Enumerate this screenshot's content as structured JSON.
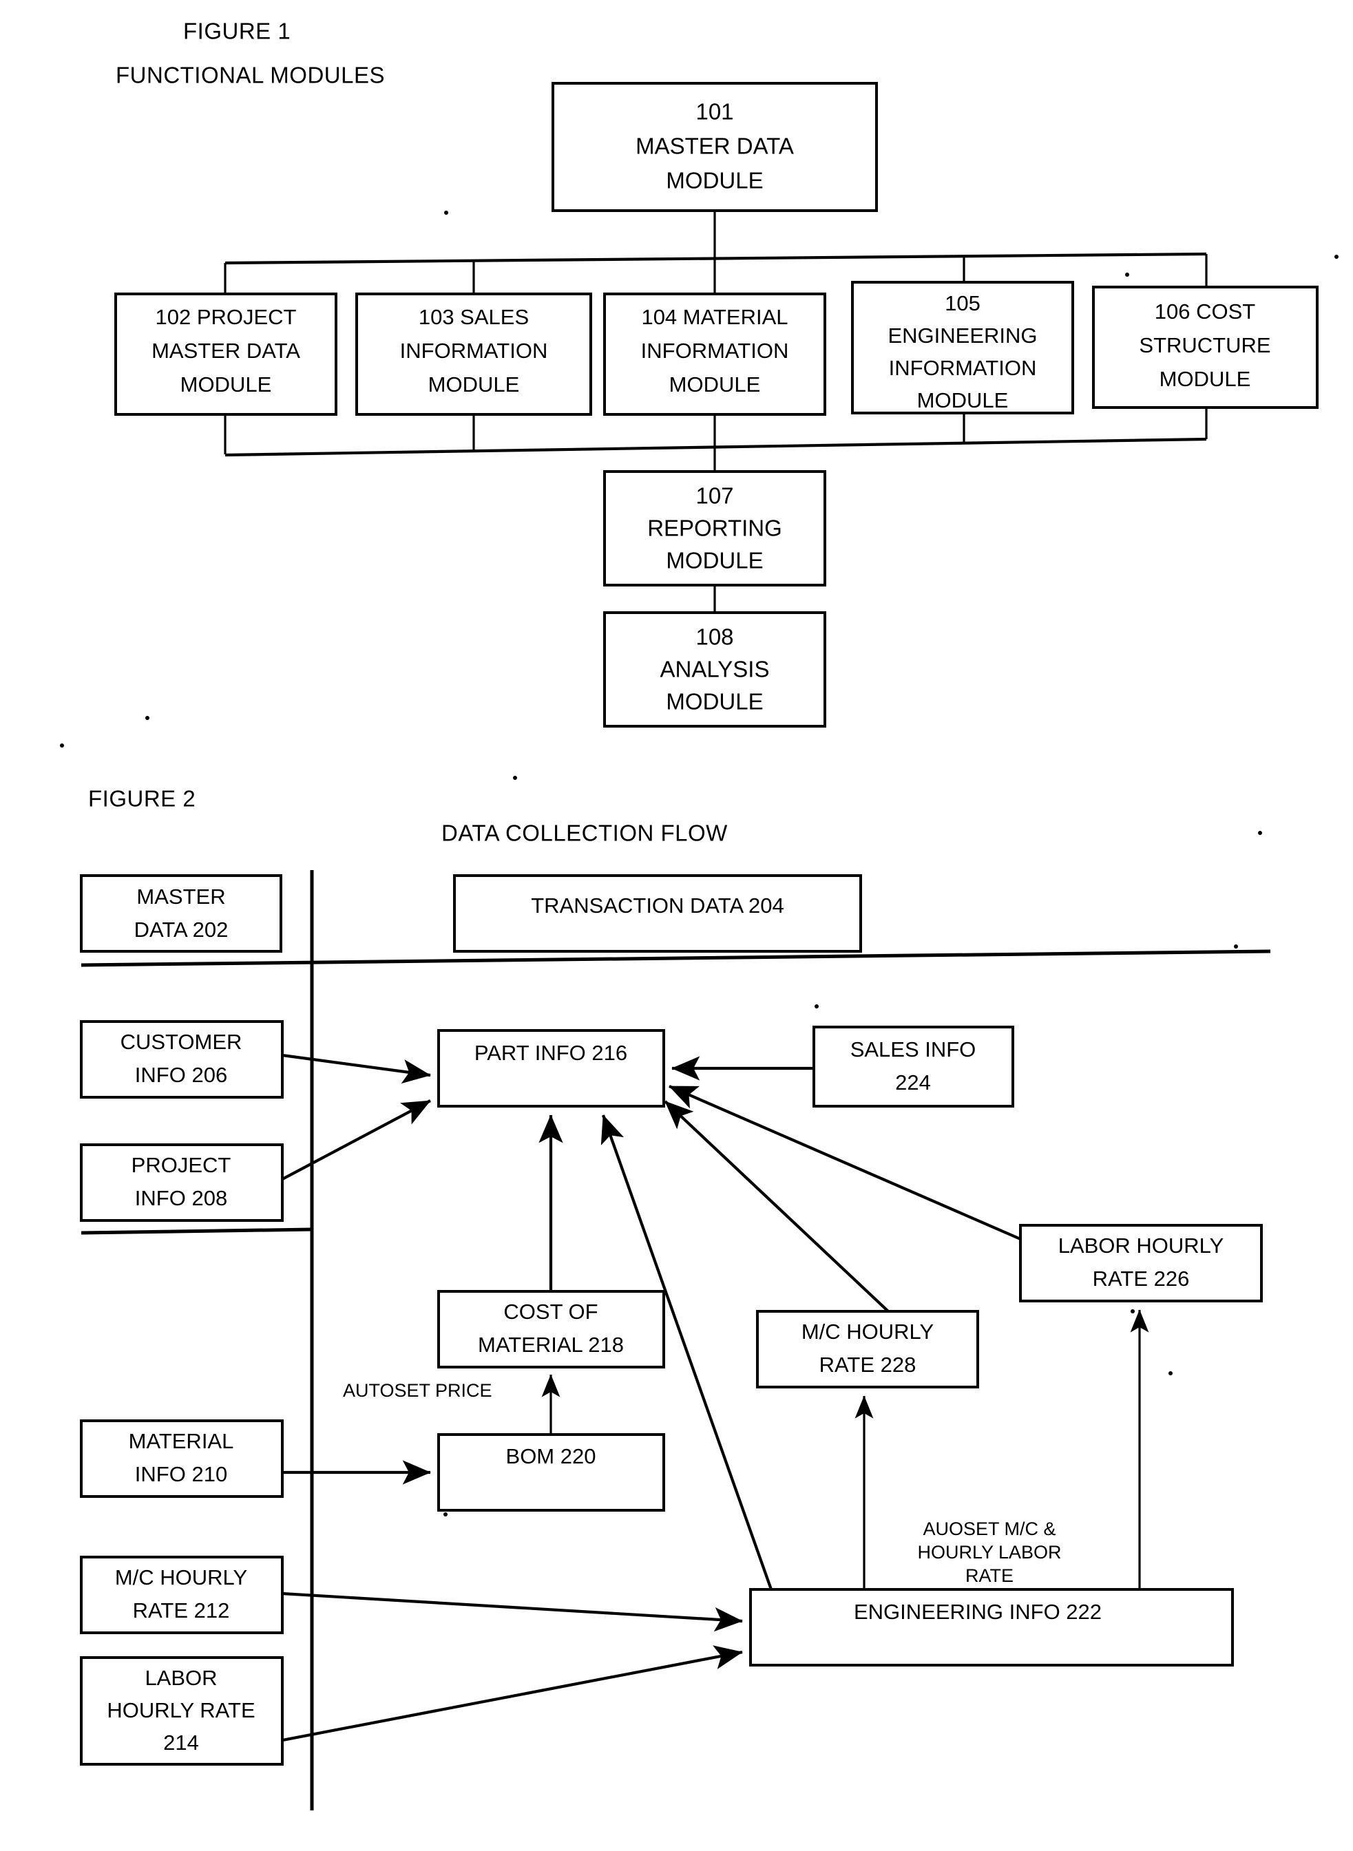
{
  "sheet": {
    "figure1": {
      "figure_label": "FIGURE 1",
      "heading": "FUNCTIONAL MODULES",
      "boxes": {
        "master": {
          "line1": "101",
          "line2": "MASTER DATA",
          "line3": "MODULE"
        },
        "project": {
          "line1": "102 PROJECT",
          "line2": "MASTER DATA",
          "line3": "MODULE"
        },
        "sales": {
          "line1": "103 SALES",
          "line2": "INFORMATION",
          "line3": "MODULE"
        },
        "material": {
          "line1": "104 MATERIAL",
          "line2": "INFORMATION",
          "line3": "MODULE"
        },
        "engineering": {
          "line1": "105",
          "line2": "ENGINEERING",
          "line3": "INFORMATION",
          "line4": "MODULE"
        },
        "cost": {
          "line1": "106 COST",
          "line2": "STRUCTURE",
          "line3": "MODULE"
        },
        "reporting": {
          "line1": "107",
          "line2": "REPORTING",
          "line3": "MODULE"
        },
        "analysis": {
          "line1": "108",
          "line2": "ANALYSIS",
          "line3": "MODULE"
        }
      }
    },
    "figure2": {
      "figure_label": "FIGURE 2",
      "heading": "DATA COLLECTION FLOW",
      "boxes": {
        "master_data": {
          "line1": "MASTER",
          "line2": "DATA 202"
        },
        "transaction_data": {
          "line1": "TRANSACTION DATA 204"
        },
        "customer_info": {
          "line1": "CUSTOMER",
          "line2": "INFO 206"
        },
        "project_info": {
          "line1": "PROJECT",
          "line2": "INFO 208"
        },
        "material_info": {
          "line1": "MATERIAL",
          "line2": "INFO 210"
        },
        "mc_hourly_rate_212": {
          "line1": "M/C HOURLY",
          "line2": "RATE 212"
        },
        "labor_hourly_rate_214": {
          "line1": "LABOR",
          "line2": "HOURLY RATE",
          "line3": "214"
        },
        "part_info": {
          "line1": "PART INFO 216"
        },
        "cost_of_material": {
          "line1": "COST OF",
          "line2": "MATERIAL 218"
        },
        "bom": {
          "line1": "BOM 220"
        },
        "engineering_info": {
          "line1": "ENGINEERING INFO 222"
        },
        "sales_info": {
          "line1": "SALES INFO",
          "line2": "224"
        },
        "labor_hourly_rate_226": {
          "line1": "LABOR HOURLY",
          "line2": "RATE 226"
        },
        "mc_hourly_rate_228": {
          "line1": "M/C HOURLY",
          "line2": "RATE 228"
        }
      },
      "annotations": {
        "autoset_price": "AUTOSET PRICE",
        "auoset_mc_line1": "AUOSET M/C &",
        "auoset_mc_line2": "HOURLY LABOR",
        "auoset_mc_line3": "RATE"
      }
    }
  },
  "colors": {
    "ink": "#000000",
    "paper": "#ffffff"
  }
}
